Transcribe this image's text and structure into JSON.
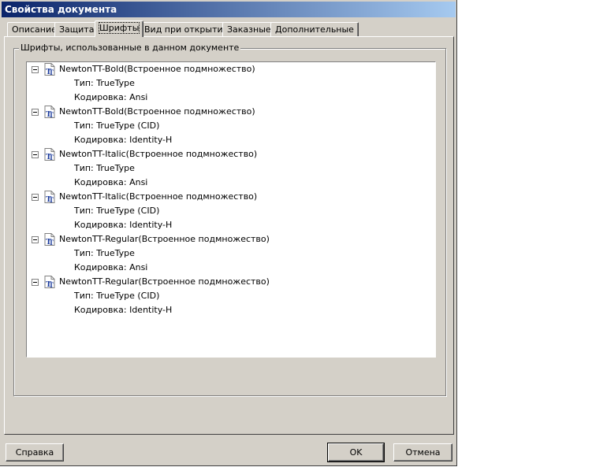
{
  "window": {
    "title": "Свойства документа"
  },
  "tabs": [
    {
      "label": "Описание",
      "active": false
    },
    {
      "label": "Защита",
      "active": false
    },
    {
      "label": "Шрифты",
      "active": true
    },
    {
      "label": "Вид при открытии",
      "active": false
    },
    {
      "label": "Заказные",
      "active": false
    },
    {
      "label": "Дополнительные",
      "active": false
    }
  ],
  "fonts_group": {
    "label": "Шрифты, использованные в данном документе",
    "fonts": [
      {
        "name": "NewtonTT-Bold(Встроенное подмножество)",
        "type": "Тип: TrueType",
        "encoding": "Кодировка: Ansi",
        "icon": "truetype-font-icon"
      },
      {
        "name": "NewtonTT-Bold(Встроенное подмножество)",
        "type": "Тип: TrueType (CID)",
        "encoding": "Кодировка: Identity-H",
        "icon": "truetype-font-icon"
      },
      {
        "name": "NewtonTT-Italic(Встроенное подмножество)",
        "type": "Тип: TrueType",
        "encoding": "Кодировка: Ansi",
        "icon": "truetype-font-icon"
      },
      {
        "name": "NewtonTT-Italic(Встроенное подмножество)",
        "type": "Тип: TrueType (CID)",
        "encoding": "Кодировка: Identity-H",
        "icon": "truetype-font-icon"
      },
      {
        "name": "NewtonTT-Regular(Встроенное подмножество)",
        "type": "Тип: TrueType",
        "encoding": "Кодировка: Ansi",
        "icon": "truetype-font-icon"
      },
      {
        "name": "NewtonTT-Regular(Встроенное подмножество)",
        "type": "Тип: TrueType (CID)",
        "encoding": "Кодировка: Identity-H",
        "icon": "truetype-font-icon"
      }
    ]
  },
  "buttons": {
    "help": "Справка",
    "ok": "OK",
    "cancel": "Отмена"
  },
  "colors": {
    "titlebar_start": "#0a246a",
    "titlebar_end": "#a6caf0",
    "face": "#d4d0c8"
  }
}
